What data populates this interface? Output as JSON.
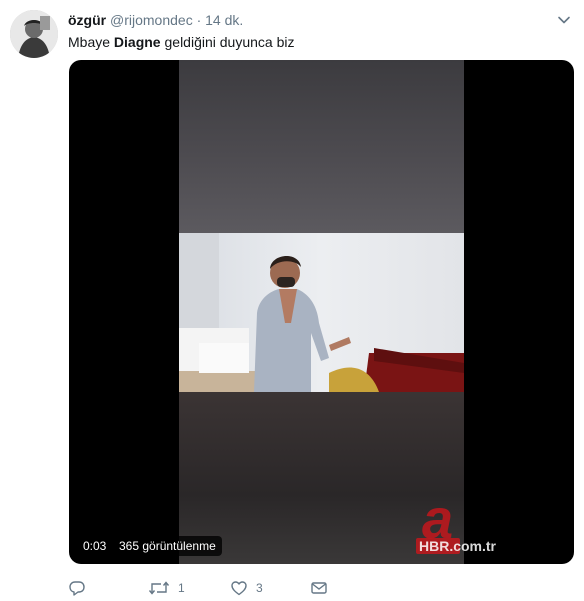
{
  "tweet": {
    "author_name": "özgür",
    "author_handle": "@rijomondec",
    "separator": "·",
    "timestamp": "14 dk.",
    "text_before": "Mbaye ",
    "text_bold": "Diagne",
    "text_after": " geldiğini duyunca biz"
  },
  "video": {
    "elapsed": "0:03",
    "views": "365 görüntülenme",
    "watermark_letter": "a",
    "watermark_text": "HBR.com.tr"
  },
  "actions": {
    "reply_count": "",
    "retweet_count": "1",
    "like_count": "3"
  },
  "colors": {
    "text_primary": "#14171a",
    "text_secondary": "#657786",
    "watermark_red": "#d7141a"
  }
}
